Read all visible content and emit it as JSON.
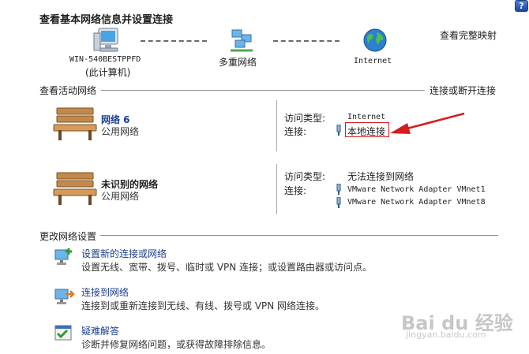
{
  "help_button": "?",
  "header": {
    "title": "查看基本网络信息并设置连接",
    "full_map_link": "查看完整映射"
  },
  "network_map": {
    "computer_name": "WIN-540BESTPPFD",
    "computer_sub": "(此计算机)",
    "middle_label": "多重网络",
    "internet_label": "Internet"
  },
  "active_networks": {
    "section_title": "查看活动网络",
    "connect_link": "连接或断开连接",
    "networks": [
      {
        "name": "网络  6",
        "category": "公用网络",
        "access_label": "访问类型:",
        "access_value": "Internet",
        "conn_label": "连接:",
        "connections": [
          "本地连接"
        ]
      },
      {
        "name": "未识别的网络",
        "category": "公用网络",
        "access_label": "访问类型:",
        "access_value": "无法连接到网络",
        "conn_label": "连接:",
        "connections": [
          "VMware Network Adapter VMnet1",
          "VMware Network Adapter VMnet8"
        ]
      }
    ]
  },
  "change_settings": {
    "section_title": "更改网络设置",
    "items": [
      {
        "title": "设置新的连接或网络",
        "desc": "设置无线、宽带、拨号、临时或 VPN 连接；或设置路由器或访问点。"
      },
      {
        "title": "连接到网络",
        "desc": "连接到或重新连接到无线、有线、拨号或 VPN 网络连接。"
      },
      {
        "title": "疑难解答",
        "desc": "诊断并修复网络问题，或获得故障排除信息。"
      }
    ]
  },
  "watermark": {
    "logo": "Bai du 经验",
    "url": "jingyan.baidu.com"
  },
  "colors": {
    "link": "#1a3f8f",
    "annotation_red": "#d21e1e",
    "rule": "#8a8a8a"
  }
}
